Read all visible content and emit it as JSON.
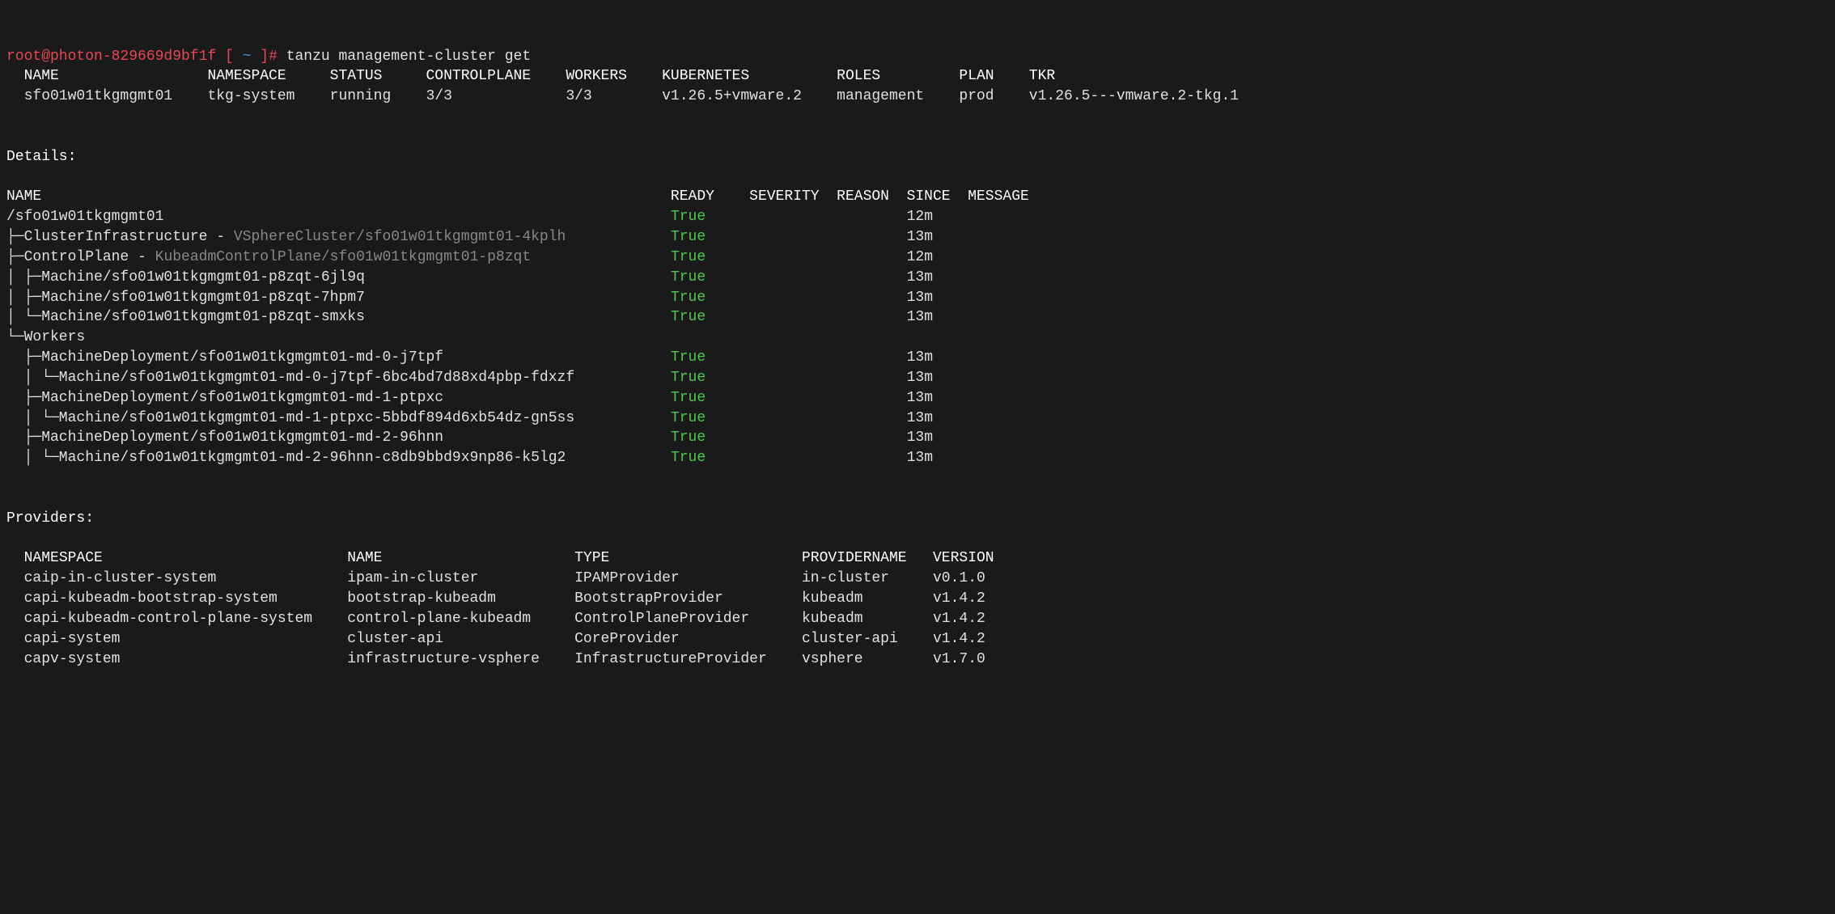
{
  "prompt": {
    "user": "root@photon-829669d9bf1f",
    "lbracket": " [ ",
    "path": "~",
    "rbracket": " ]# ",
    "command": "tanzu management-cluster get"
  },
  "table1": {
    "headers": {
      "name": "NAME",
      "namespace": "NAMESPACE",
      "status": "STATUS",
      "controlplane": "CONTROLPLANE",
      "workers": "WORKERS",
      "kubernetes": "KUBERNETES",
      "roles": "ROLES",
      "plan": "PLAN",
      "tkr": "TKR"
    },
    "row": {
      "name": "sfo01w01tkgmgmt01",
      "namespace": "tkg-system",
      "status": "running",
      "controlplane": "3/3",
      "workers": "3/3",
      "kubernetes": "v1.26.5+vmware.2",
      "roles": "management",
      "plan": "prod",
      "tkr": "v1.26.5---vmware.2-tkg.1"
    }
  },
  "details_label": "Details:",
  "tree": {
    "headers": {
      "name": "NAME",
      "ready": "READY",
      "severity": "SEVERITY",
      "reason": "REASON",
      "since": "SINCE",
      "message": "MESSAGE"
    },
    "rows": [
      {
        "prefix": "",
        "name": "/sfo01w01tkgmgmt01",
        "dimpart": "",
        "ready": "True",
        "since": "12m"
      },
      {
        "prefix": "├─",
        "name": "ClusterInfrastructure - ",
        "dimpart": "VSphereCluster/sfo01w01tkgmgmt01-4kplh",
        "ready": "True",
        "since": "13m"
      },
      {
        "prefix": "├─",
        "name": "ControlPlane - ",
        "dimpart": "KubeadmControlPlane/sfo01w01tkgmgmt01-p8zqt",
        "ready": "True",
        "since": "12m"
      },
      {
        "prefix": "│ ├─",
        "name": "Machine/sfo01w01tkgmgmt01-p8zqt-6jl9q",
        "dimpart": "",
        "ready": "True",
        "since": "13m"
      },
      {
        "prefix": "│ ├─",
        "name": "Machine/sfo01w01tkgmgmt01-p8zqt-7hpm7",
        "dimpart": "",
        "ready": "True",
        "since": "13m"
      },
      {
        "prefix": "│ └─",
        "name": "Machine/sfo01w01tkgmgmt01-p8zqt-smxks",
        "dimpart": "",
        "ready": "True",
        "since": "13m"
      },
      {
        "prefix": "└─",
        "name": "Workers",
        "dimpart": "",
        "ready": "",
        "since": ""
      },
      {
        "prefix": "  ├─",
        "name": "MachineDeployment/sfo01w01tkgmgmt01-md-0-j7tpf",
        "dimpart": "",
        "ready": "True",
        "since": "13m"
      },
      {
        "prefix": "  │ └─",
        "name": "Machine/sfo01w01tkgmgmt01-md-0-j7tpf-6bc4bd7d88xd4pbp-fdxzf",
        "dimpart": "",
        "ready": "True",
        "since": "13m"
      },
      {
        "prefix": "  ├─",
        "name": "MachineDeployment/sfo01w01tkgmgmt01-md-1-ptpxc",
        "dimpart": "",
        "ready": "True",
        "since": "13m"
      },
      {
        "prefix": "  │ └─",
        "name": "Machine/sfo01w01tkgmgmt01-md-1-ptpxc-5bbdf894d6xb54dz-gn5ss",
        "dimpart": "",
        "ready": "True",
        "since": "13m"
      },
      {
        "prefix": "  ├─",
        "name": "MachineDeployment/sfo01w01tkgmgmt01-md-2-96hnn",
        "dimpart": "",
        "ready": "True",
        "since": "13m"
      },
      {
        "prefix": "  │ └─",
        "name": "Machine/sfo01w01tkgmgmt01-md-2-96hnn-c8db9bbd9x9np86-k5lg2",
        "dimpart": "",
        "ready": "True",
        "since": "13m"
      }
    ]
  },
  "providers_label": "Providers:",
  "providers": {
    "headers": {
      "namespace": "NAMESPACE",
      "name": "NAME",
      "type": "TYPE",
      "providername": "PROVIDERNAME",
      "version": "VERSION"
    },
    "rows": [
      {
        "namespace": "caip-in-cluster-system",
        "name": "ipam-in-cluster",
        "type": "IPAMProvider",
        "providername": "in-cluster",
        "version": "v0.1.0"
      },
      {
        "namespace": "capi-kubeadm-bootstrap-system",
        "name": "bootstrap-kubeadm",
        "type": "BootstrapProvider",
        "providername": "kubeadm",
        "version": "v1.4.2"
      },
      {
        "namespace": "capi-kubeadm-control-plane-system",
        "name": "control-plane-kubeadm",
        "type": "ControlPlaneProvider",
        "providername": "kubeadm",
        "version": "v1.4.2"
      },
      {
        "namespace": "capi-system",
        "name": "cluster-api",
        "type": "CoreProvider",
        "providername": "cluster-api",
        "version": "v1.4.2"
      },
      {
        "namespace": "capv-system",
        "name": "infrastructure-vsphere",
        "type": "InfrastructureProvider",
        "providername": "vsphere",
        "version": "v1.7.0"
      }
    ]
  }
}
